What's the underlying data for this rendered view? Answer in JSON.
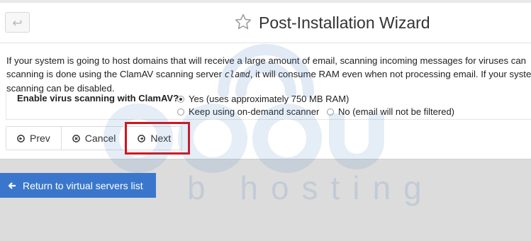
{
  "header": {
    "back_icon": "undo-arrow-icon",
    "star_icon": "star-outline-icon",
    "title": "Post-Installation Wizard"
  },
  "description": {
    "line1": "If your system is going to host domains that will receive a large amount of email, scanning incoming messages for viruses can",
    "line2_before": "scanning is done using the ClamAV scanning server ",
    "line2_code": "clamd",
    "line2_after": ", it will consume RAM even when not processing email. If your system",
    "line3": "scanning can be disabled."
  },
  "form": {
    "label": "Enable virus scanning with ClamAV?",
    "options": [
      {
        "label": "Yes (uses approximately 750 MB RAM)",
        "selected": true
      },
      {
        "label": "Keep using on-demand scanner",
        "selected": false
      },
      {
        "label": "No (email will not be filtered)",
        "selected": false
      }
    ]
  },
  "buttons": {
    "prev": "Prev",
    "cancel": "Cancel",
    "next": "Next"
  },
  "return_button": {
    "label": "Return to virtual servers list",
    "icon": "arrow-left-icon"
  },
  "watermark": {
    "text": "b hosting"
  },
  "colors": {
    "accent": "#3a77cc",
    "highlight": "#d4121e",
    "background": "#dcdcdc"
  }
}
